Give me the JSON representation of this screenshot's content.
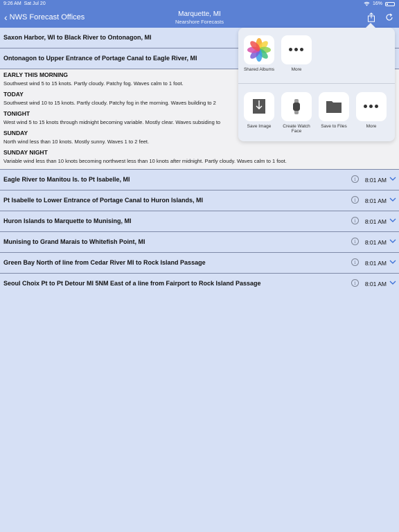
{
  "status": {
    "time": "9:26 AM",
    "date": "Sat Jul 20",
    "battery": "16%"
  },
  "nav": {
    "back_label": "NWS Forecast Offices",
    "title": "Marquette, MI",
    "subtitle": "Nearshore Forecasts"
  },
  "expanded_rows": [
    {
      "title": "Saxon Harbor, WI to Black River to Ontonagon, MI"
    },
    {
      "title": "Ontonagon to Upper Entrance of Portage Canal to Eagle River, MI"
    }
  ],
  "forecast": [
    {
      "period": "EARLY THIS MORNING",
      "text": "Southwest wind 5 to 15 knots. Partly cloudy. Patchy fog. Waves calm to 1 foot."
    },
    {
      "period": "TODAY",
      "text": "Southwest wind 10 to 15 knots. Partly cloudy. Patchy fog in the morning. Waves building to 2"
    },
    {
      "period": "TONIGHT",
      "text": "West wind 5 to 15 knots through midnight becoming variable. Mostly clear. Waves subsiding to"
    },
    {
      "period": "SUNDAY",
      "text": "North wind less than 10 knots. Mostly sunny. Waves 1 to 2 feet."
    },
    {
      "period": "SUNDAY NIGHT",
      "text": "Variable wind less than 10 knots becoming northwest less than 10 knots after midnight. Partly cloudy. Waves calm to 1 foot."
    }
  ],
  "rows": [
    {
      "title": "Eagle River to Manitou Is. to Pt Isabelle, MI",
      "time": "8:01 AM"
    },
    {
      "title": "Pt Isabelle to Lower Entrance of Portage Canal to Huron Islands, MI",
      "time": "8:01 AM"
    },
    {
      "title": "Huron Islands to Marquette to Munising, MI",
      "time": "8:01 AM"
    },
    {
      "title": "Munising to Grand Marais to Whitefish Point, MI",
      "time": "8:01 AM"
    },
    {
      "title": "Green Bay North of line from Cedar River MI to Rock Island Passage",
      "time": "8:01 AM"
    },
    {
      "title": "Seoul Choix Pt to Pt Detour MI 5NM East of a line from Fairport to Rock Island Passage",
      "time": "8:01 AM"
    }
  ],
  "share": {
    "top": [
      {
        "label": "Shared Albums",
        "icon": "photos-icon"
      },
      {
        "label": "More",
        "icon": "more-icon"
      }
    ],
    "bottom": [
      {
        "label": "Save Image",
        "icon": "save-image-icon"
      },
      {
        "label": "Create Watch Face",
        "icon": "watch-icon"
      },
      {
        "label": "Save to Files",
        "icon": "folder-icon"
      },
      {
        "label": "More",
        "icon": "more-icon"
      }
    ]
  },
  "colors": {
    "nav": "#5b81d4",
    "list_bg": "#d6e0f5",
    "accent": "#3a6fd6"
  }
}
